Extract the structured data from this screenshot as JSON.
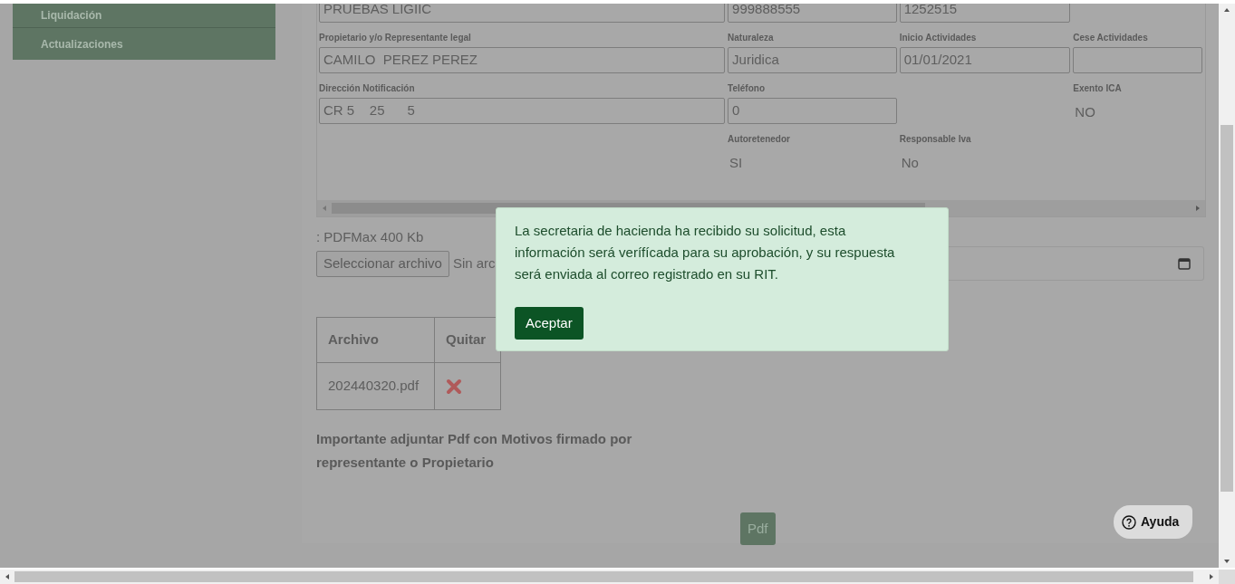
{
  "sidebar": {
    "items": [
      {
        "label": "Liquidación"
      },
      {
        "label": "Actualizaciones"
      }
    ]
  },
  "form": {
    "rows": [
      [
        {
          "kind": "input",
          "value": "PRUEBAS LIGIIC"
        },
        {
          "kind": "input",
          "value": "999888555"
        },
        {
          "kind": "input",
          "value": "1252515"
        },
        {
          "kind": "empty"
        }
      ],
      [
        {
          "kind": "input",
          "label": "Propietario y/o Representante legal",
          "value": "CAMILO  PEREZ PEREZ"
        },
        {
          "kind": "input",
          "label": "Naturaleza",
          "value": "Juridica"
        },
        {
          "kind": "input",
          "label": "Inicio Actividades",
          "value": "01/01/2021"
        },
        {
          "kind": "input",
          "label": "Cese Actividades"
        }
      ],
      [
        {
          "kind": "input",
          "label": "Dirección Notificación",
          "value": "CR 5    25      5"
        },
        {
          "kind": "input",
          "label": "Teléfono",
          "value": "0"
        },
        {
          "kind": "empty"
        },
        {
          "kind": "text",
          "label": "Exento ICA",
          "value": "NO"
        }
      ],
      [
        {
          "kind": "empty"
        },
        {
          "kind": "text",
          "label": "Autoretenedor",
          "value": "SI"
        },
        {
          "kind": "text",
          "label": "Responsable Iva",
          "value": "No"
        },
        {
          "kind": "empty"
        }
      ]
    ]
  },
  "upload": {
    "hint": ": PDFMax 400 Kb",
    "button": "Seleccionar archivo",
    "status": "Sin arc"
  },
  "files_table": {
    "columns": [
      "Archivo",
      "Quitar"
    ],
    "rows": [
      {
        "name": "202440320.pdf"
      }
    ]
  },
  "note": "Importante adjuntar Pdf con Motivos firmado por representante o Propietario",
  "pdf_button": "Pdf",
  "help_button": "Ayuda",
  "dialog": {
    "message": "La secretaria de hacienda ha recibido su solicitud, esta información será verífícada para su aprobación, y su respuesta será enviada al correo registrado en su RIT.",
    "button": "Aceptar"
  }
}
